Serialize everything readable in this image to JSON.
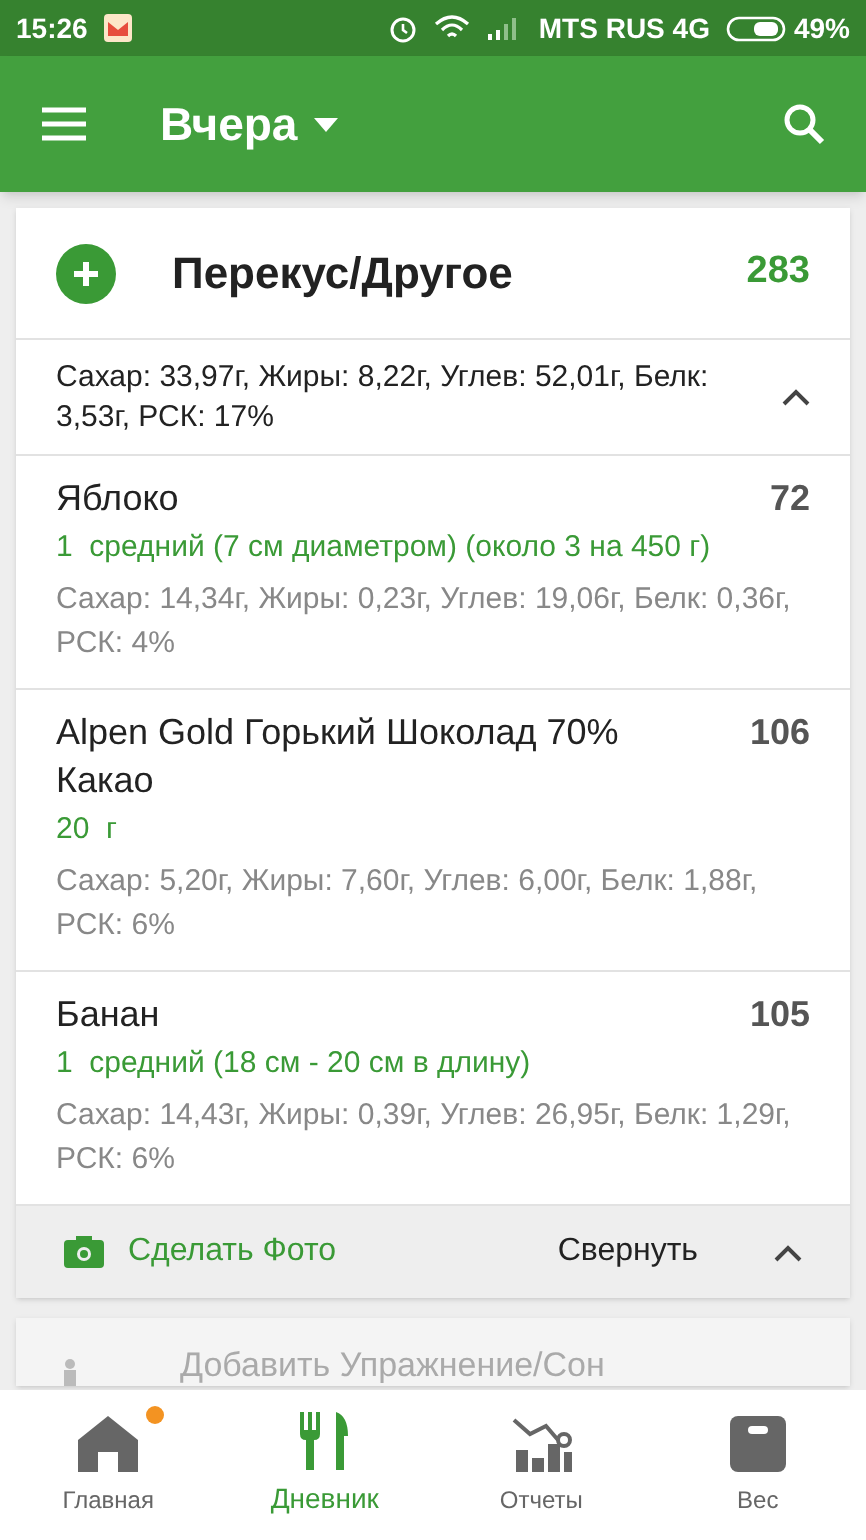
{
  "status_bar": {
    "time": "15:26",
    "carrier": "MTS RUS 4G",
    "battery": "49%"
  },
  "app_bar": {
    "title": "Вчера"
  },
  "meal": {
    "title": "Перекус/Другое",
    "calories": "283",
    "summary": "Сахар: 33,97г, Жиры: 8,22г, Углев: 52,01г, Белк: 3,53г, РСК: 17%",
    "expanded": true,
    "items": [
      {
        "name": "Яблоко",
        "calories": "72",
        "portion": "1  средний (7 см диаметром) (около 3 на 450 г)",
        "details": "Сахар: 14,34г, Жиры: 0,23г, Углев: 19,06г, Белк: 0,36г, РСК: 4%"
      },
      {
        "name": "Alpen Gold Горький Шоколад 70% Какао",
        "calories": "106",
        "portion": "20  г",
        "details": "Сахар: 5,20г, Жиры: 7,60г, Углев: 6,00г, Белк: 1,88г, РСК: 6%"
      },
      {
        "name": "Банан",
        "calories": "105",
        "portion": "1  средний (18 см - 20 см в длину)",
        "details": "Сахар: 14,43г, Жиры: 0,39г, Углев: 26,95г, Белк: 1,29г, РСК: 6%"
      }
    ],
    "photo_button": "Сделать Фото",
    "collapse_button": "Свернуть"
  },
  "next_card": {
    "label": "Добавить Упражнение/Сон"
  },
  "bottom_nav": [
    {
      "kind": "home",
      "label": "Главная",
      "selected": false,
      "badge": true
    },
    {
      "kind": "diary",
      "label": "Дневник",
      "selected": true,
      "badge": false
    },
    {
      "kind": "reports",
      "label": "Отчеты",
      "selected": false,
      "badge": false
    },
    {
      "kind": "weight",
      "label": "Вес",
      "selected": false,
      "badge": false
    }
  ]
}
